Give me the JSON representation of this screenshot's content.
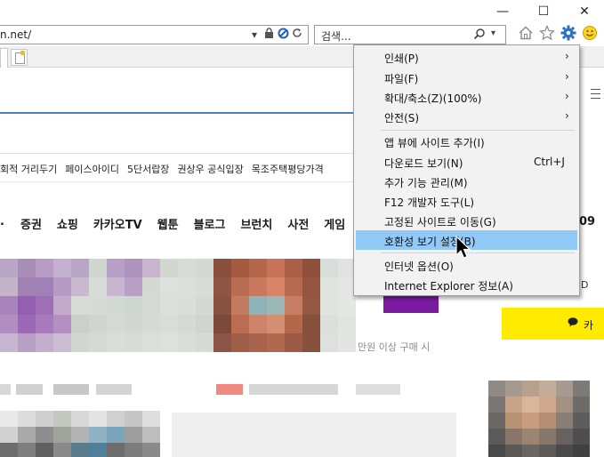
{
  "titlebar": {
    "minimize_glyph": "—",
    "maximize_glyph": "☐",
    "close_glyph": "✕"
  },
  "address_bar": {
    "url": "n.net/"
  },
  "search_box": {
    "placeholder": "검색..."
  },
  "keywords": [
    "회적 거리두기",
    "페이스아이디",
    "5단서랍장",
    "권상우 공식입장",
    "목조주택평당가격"
  ],
  "nav_tabs": [
    "증권",
    "쇼핑",
    "카카오TV",
    "웹툰",
    "블로그",
    "브런치",
    "사전",
    "게임"
  ],
  "page_misc": {
    "right_partial_text": "09",
    "right_partial_small": "D",
    "kakao_partial": "카",
    "ad_text": "만원 이상 구매 시"
  },
  "tools_menu": {
    "groups": [
      [
        {
          "label": "인쇄(P)",
          "submenu": true
        },
        {
          "label": "파일(F)",
          "submenu": true
        },
        {
          "label": "확대/축소(Z)(100%)",
          "submenu": true
        },
        {
          "label": "안전(S)",
          "submenu": true
        }
      ],
      [
        {
          "label": "앱 뷰에 사이트 추가(I)",
          "accelerator": ""
        },
        {
          "label": "다운로드 보기(N)",
          "accelerator": "Ctrl+J"
        },
        {
          "label": "추가 기능 관리(M)",
          "accelerator": ""
        },
        {
          "label": "F12 개발자 도구(L)",
          "accelerator": ""
        },
        {
          "label": "고정된 사이트로 이동(G)",
          "accelerator": ""
        },
        {
          "label": "호환성 보기 설정(B)",
          "accelerator": "",
          "highlighted": true
        }
      ],
      [
        {
          "label": "인터넷 옵션(O)",
          "accelerator": ""
        },
        {
          "label": "Internet Explorer 정보(A)",
          "accelerator": ""
        }
      ]
    ],
    "submenu_arrow": "›"
  },
  "colors": {
    "menu_bg": "#f2f2f2",
    "highlight": "#91c9f7",
    "search_line": "#4d82b8",
    "kakao_yellow": "#ffeb00",
    "ad_purple": "#7a1aa0"
  }
}
